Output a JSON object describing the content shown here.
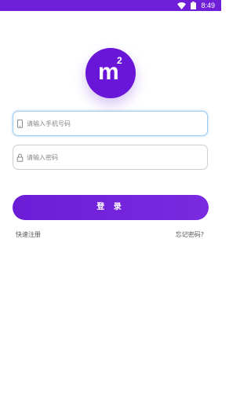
{
  "status_bar": {
    "time": "8:49",
    "wifi_icon": "wifi-icon",
    "battery_icon": "battery-icon",
    "background": "#6f1fd8"
  },
  "logo": {
    "letter": "m",
    "superscript": "2",
    "background": "#6a16d8"
  },
  "form": {
    "phone": {
      "placeholder": "请输入手机号码",
      "value": "",
      "icon": "phone-icon"
    },
    "password": {
      "placeholder": "请输入密码",
      "value": "",
      "icon": "lock-icon"
    },
    "login_label": "登 录"
  },
  "links": {
    "quick_register": "快速注册",
    "forgot_password": "忘记密码?"
  },
  "colors": {
    "accent": "#6c1cd6",
    "active_border": "#9ecbf0"
  }
}
